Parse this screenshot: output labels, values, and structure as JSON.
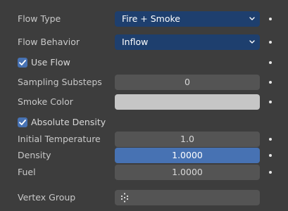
{
  "flow_type": {
    "label": "Flow Type",
    "value": "Fire + Smoke"
  },
  "flow_behavior": {
    "label": "Flow Behavior",
    "value": "Inflow"
  },
  "use_flow": {
    "label": "Use Flow",
    "checked": true
  },
  "sampling_substeps": {
    "label": "Sampling Substeps",
    "value": "0"
  },
  "smoke_color": {
    "label": "Smoke Color",
    "color": "#c6c6c6"
  },
  "absolute_density": {
    "label": "Absolute Density",
    "checked": true
  },
  "initial_temperature": {
    "label": "Initial Temperature",
    "value": "1.0"
  },
  "density": {
    "label": "Density",
    "value": "1.0000"
  },
  "fuel": {
    "label": "Fuel",
    "value": "1.0000"
  },
  "vertex_group": {
    "label": "Vertex Group",
    "value": ""
  },
  "colors": {
    "panel_bg": "#3d3d3d",
    "dropdown_bg": "#1e3f6e",
    "field_bg": "#545454",
    "active_field_bg": "#4772b3",
    "checkbox_bg": "#4772b3"
  },
  "icons": {
    "dropdown": "chevron-down-icon",
    "checkbox": "checkmark-icon",
    "vertex_group": "vertex-group-icon",
    "animate": "keyframe-dot-icon"
  }
}
